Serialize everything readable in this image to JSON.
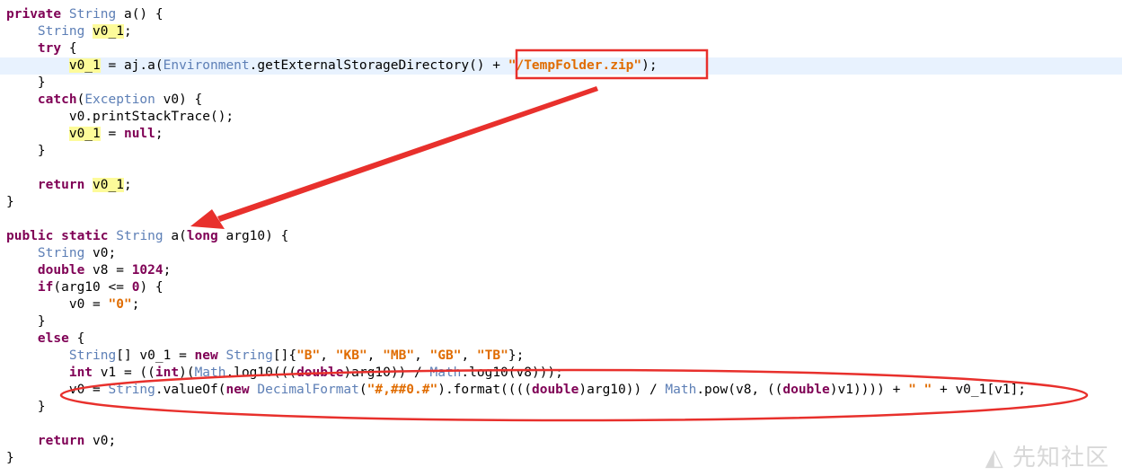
{
  "editor": {
    "lines": [
      {
        "current": false,
        "tokens": [
          [
            "kw",
            "private"
          ],
          [
            "p",
            " "
          ],
          [
            "t",
            "String"
          ],
          [
            "p",
            " a() {"
          ]
        ]
      },
      {
        "current": false,
        "tokens": [
          [
            "p",
            "    "
          ],
          [
            "t",
            "String"
          ],
          [
            "p",
            " "
          ],
          [
            "hl",
            "v0_1"
          ],
          [
            "p",
            ";"
          ]
        ]
      },
      {
        "current": false,
        "tokens": [
          [
            "p",
            "    "
          ],
          [
            "kw",
            "try"
          ],
          [
            "p",
            " {"
          ]
        ]
      },
      {
        "current": true,
        "tokens": [
          [
            "p",
            "        "
          ],
          [
            "hl",
            "v0_1"
          ],
          [
            "p",
            " = aj.a("
          ],
          [
            "t",
            "Environment"
          ],
          [
            "p",
            ".getExternalStorageDirectory() + "
          ],
          [
            "s",
            "\"/TempFolder.zip\""
          ],
          [
            "p",
            ");"
          ]
        ]
      },
      {
        "current": false,
        "tokens": [
          [
            "p",
            "    }"
          ]
        ]
      },
      {
        "current": false,
        "tokens": [
          [
            "p",
            "    "
          ],
          [
            "kw",
            "catch"
          ],
          [
            "p",
            "("
          ],
          [
            "t",
            "Exception"
          ],
          [
            "p",
            " v0) {"
          ]
        ]
      },
      {
        "current": false,
        "tokens": [
          [
            "p",
            "        v0.printStackTrace();"
          ]
        ]
      },
      {
        "current": false,
        "tokens": [
          [
            "p",
            "        "
          ],
          [
            "hl",
            "v0_1"
          ],
          [
            "p",
            " = "
          ],
          [
            "kw",
            "null"
          ],
          [
            "p",
            ";"
          ]
        ]
      },
      {
        "current": false,
        "tokens": [
          [
            "p",
            "    }"
          ]
        ]
      },
      {
        "current": false,
        "tokens": []
      },
      {
        "current": false,
        "tokens": [
          [
            "p",
            "    "
          ],
          [
            "kw",
            "return"
          ],
          [
            "p",
            " "
          ],
          [
            "hl",
            "v0_1"
          ],
          [
            "p",
            ";"
          ]
        ]
      },
      {
        "current": false,
        "tokens": [
          [
            "p",
            "}"
          ]
        ]
      },
      {
        "current": false,
        "tokens": []
      },
      {
        "current": false,
        "tokens": [
          [
            "kw",
            "public"
          ],
          [
            "p",
            " "
          ],
          [
            "kw",
            "static"
          ],
          [
            "p",
            " "
          ],
          [
            "t",
            "String"
          ],
          [
            "p",
            " a("
          ],
          [
            "kw",
            "long"
          ],
          [
            "p",
            " arg10) {"
          ]
        ]
      },
      {
        "current": false,
        "tokens": [
          [
            "p",
            "    "
          ],
          [
            "t",
            "String"
          ],
          [
            "p",
            " v0;"
          ]
        ]
      },
      {
        "current": false,
        "tokens": [
          [
            "p",
            "    "
          ],
          [
            "kw",
            "double"
          ],
          [
            "p",
            " v8 = "
          ],
          [
            "kw",
            "1024"
          ],
          [
            "p",
            ";"
          ]
        ]
      },
      {
        "current": false,
        "tokens": [
          [
            "p",
            "    "
          ],
          [
            "kw",
            "if"
          ],
          [
            "p",
            "(arg10 <= "
          ],
          [
            "kw",
            "0"
          ],
          [
            "p",
            ") {"
          ]
        ]
      },
      {
        "current": false,
        "tokens": [
          [
            "p",
            "        v0 = "
          ],
          [
            "s",
            "\"0\""
          ],
          [
            "p",
            ";"
          ]
        ]
      },
      {
        "current": false,
        "tokens": [
          [
            "p",
            "    }"
          ]
        ]
      },
      {
        "current": false,
        "tokens": [
          [
            "p",
            "    "
          ],
          [
            "kw",
            "else"
          ],
          [
            "p",
            " {"
          ]
        ]
      },
      {
        "current": false,
        "tokens": [
          [
            "p",
            "        "
          ],
          [
            "t",
            "String"
          ],
          [
            "p",
            "[] v0_1 = "
          ],
          [
            "kw",
            "new"
          ],
          [
            "p",
            " "
          ],
          [
            "t",
            "String"
          ],
          [
            "p",
            "[]{"
          ],
          [
            "s",
            "\"B\""
          ],
          [
            "p",
            ", "
          ],
          [
            "s",
            "\"KB\""
          ],
          [
            "p",
            ", "
          ],
          [
            "s",
            "\"MB\""
          ],
          [
            "p",
            ", "
          ],
          [
            "s",
            "\"GB\""
          ],
          [
            "p",
            ", "
          ],
          [
            "s",
            "\"TB\""
          ],
          [
            "p",
            "};"
          ]
        ]
      },
      {
        "current": false,
        "tokens": [
          [
            "p",
            "        "
          ],
          [
            "kw",
            "int"
          ],
          [
            "p",
            " v1 = (("
          ],
          [
            "kw",
            "int"
          ],
          [
            "p",
            ")("
          ],
          [
            "t",
            "Math"
          ],
          [
            "p",
            ".log10((("
          ],
          [
            "kw",
            "double"
          ],
          [
            "p",
            ")arg10)) / "
          ],
          [
            "t",
            "Math"
          ],
          [
            "p",
            ".log10(v8)));"
          ]
        ]
      },
      {
        "current": false,
        "tokens": [
          [
            "p",
            "        v0 = "
          ],
          [
            "t",
            "String"
          ],
          [
            "p",
            ".valueOf("
          ],
          [
            "kw",
            "new"
          ],
          [
            "p",
            " "
          ],
          [
            "t",
            "DecimalFormat"
          ],
          [
            "p",
            "("
          ],
          [
            "s",
            "\"#,##0.#\""
          ],
          [
            "p",
            ").format(((("
          ],
          [
            "kw",
            "double"
          ],
          [
            "p",
            ")arg10)) / "
          ],
          [
            "t",
            "Math"
          ],
          [
            "p",
            ".pow(v8, (("
          ],
          [
            "kw",
            "double"
          ],
          [
            "p",
            ")v1)))) + "
          ],
          [
            "s",
            "\" \""
          ],
          [
            "p",
            " + v0_1[v1];"
          ]
        ]
      },
      {
        "current": false,
        "tokens": [
          [
            "p",
            "    }"
          ]
        ]
      },
      {
        "current": false,
        "tokens": []
      },
      {
        "current": false,
        "tokens": [
          [
            "p",
            "    "
          ],
          [
            "kw",
            "return"
          ],
          [
            "p",
            " v0;"
          ]
        ]
      },
      {
        "current": false,
        "tokens": [
          [
            "p",
            "}"
          ]
        ]
      }
    ]
  },
  "annotations": {
    "color": "#e8302c"
  },
  "watermark": {
    "text": "先知社区"
  }
}
